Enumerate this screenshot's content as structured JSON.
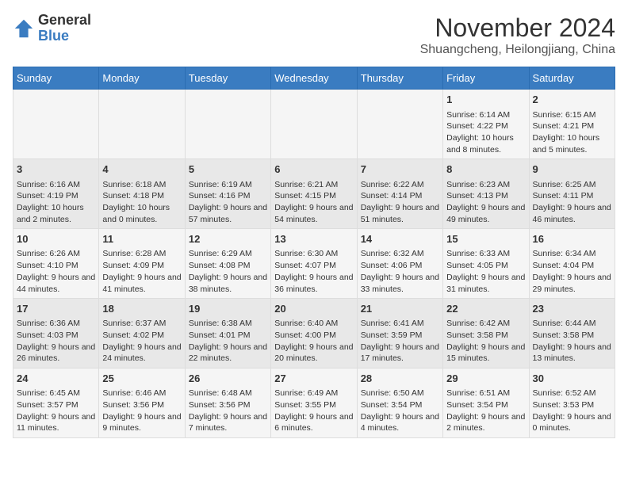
{
  "header": {
    "logo_general": "General",
    "logo_blue": "Blue",
    "month_title": "November 2024",
    "location": "Shuangcheng, Heilongjiang, China"
  },
  "days_of_week": [
    "Sunday",
    "Monday",
    "Tuesday",
    "Wednesday",
    "Thursday",
    "Friday",
    "Saturday"
  ],
  "weeks": [
    [
      {
        "day": "",
        "content": ""
      },
      {
        "day": "",
        "content": ""
      },
      {
        "day": "",
        "content": ""
      },
      {
        "day": "",
        "content": ""
      },
      {
        "day": "",
        "content": ""
      },
      {
        "day": "1",
        "content": "Sunrise: 6:14 AM\nSunset: 4:22 PM\nDaylight: 10 hours and 8 minutes."
      },
      {
        "day": "2",
        "content": "Sunrise: 6:15 AM\nSunset: 4:21 PM\nDaylight: 10 hours and 5 minutes."
      }
    ],
    [
      {
        "day": "3",
        "content": "Sunrise: 6:16 AM\nSunset: 4:19 PM\nDaylight: 10 hours and 2 minutes."
      },
      {
        "day": "4",
        "content": "Sunrise: 6:18 AM\nSunset: 4:18 PM\nDaylight: 10 hours and 0 minutes."
      },
      {
        "day": "5",
        "content": "Sunrise: 6:19 AM\nSunset: 4:16 PM\nDaylight: 9 hours and 57 minutes."
      },
      {
        "day": "6",
        "content": "Sunrise: 6:21 AM\nSunset: 4:15 PM\nDaylight: 9 hours and 54 minutes."
      },
      {
        "day": "7",
        "content": "Sunrise: 6:22 AM\nSunset: 4:14 PM\nDaylight: 9 hours and 51 minutes."
      },
      {
        "day": "8",
        "content": "Sunrise: 6:23 AM\nSunset: 4:13 PM\nDaylight: 9 hours and 49 minutes."
      },
      {
        "day": "9",
        "content": "Sunrise: 6:25 AM\nSunset: 4:11 PM\nDaylight: 9 hours and 46 minutes."
      }
    ],
    [
      {
        "day": "10",
        "content": "Sunrise: 6:26 AM\nSunset: 4:10 PM\nDaylight: 9 hours and 44 minutes."
      },
      {
        "day": "11",
        "content": "Sunrise: 6:28 AM\nSunset: 4:09 PM\nDaylight: 9 hours and 41 minutes."
      },
      {
        "day": "12",
        "content": "Sunrise: 6:29 AM\nSunset: 4:08 PM\nDaylight: 9 hours and 38 minutes."
      },
      {
        "day": "13",
        "content": "Sunrise: 6:30 AM\nSunset: 4:07 PM\nDaylight: 9 hours and 36 minutes."
      },
      {
        "day": "14",
        "content": "Sunrise: 6:32 AM\nSunset: 4:06 PM\nDaylight: 9 hours and 33 minutes."
      },
      {
        "day": "15",
        "content": "Sunrise: 6:33 AM\nSunset: 4:05 PM\nDaylight: 9 hours and 31 minutes."
      },
      {
        "day": "16",
        "content": "Sunrise: 6:34 AM\nSunset: 4:04 PM\nDaylight: 9 hours and 29 minutes."
      }
    ],
    [
      {
        "day": "17",
        "content": "Sunrise: 6:36 AM\nSunset: 4:03 PM\nDaylight: 9 hours and 26 minutes."
      },
      {
        "day": "18",
        "content": "Sunrise: 6:37 AM\nSunset: 4:02 PM\nDaylight: 9 hours and 24 minutes."
      },
      {
        "day": "19",
        "content": "Sunrise: 6:38 AM\nSunset: 4:01 PM\nDaylight: 9 hours and 22 minutes."
      },
      {
        "day": "20",
        "content": "Sunrise: 6:40 AM\nSunset: 4:00 PM\nDaylight: 9 hours and 20 minutes."
      },
      {
        "day": "21",
        "content": "Sunrise: 6:41 AM\nSunset: 3:59 PM\nDaylight: 9 hours and 17 minutes."
      },
      {
        "day": "22",
        "content": "Sunrise: 6:42 AM\nSunset: 3:58 PM\nDaylight: 9 hours and 15 minutes."
      },
      {
        "day": "23",
        "content": "Sunrise: 6:44 AM\nSunset: 3:58 PM\nDaylight: 9 hours and 13 minutes."
      }
    ],
    [
      {
        "day": "24",
        "content": "Sunrise: 6:45 AM\nSunset: 3:57 PM\nDaylight: 9 hours and 11 minutes."
      },
      {
        "day": "25",
        "content": "Sunrise: 6:46 AM\nSunset: 3:56 PM\nDaylight: 9 hours and 9 minutes."
      },
      {
        "day": "26",
        "content": "Sunrise: 6:48 AM\nSunset: 3:56 PM\nDaylight: 9 hours and 7 minutes."
      },
      {
        "day": "27",
        "content": "Sunrise: 6:49 AM\nSunset: 3:55 PM\nDaylight: 9 hours and 6 minutes."
      },
      {
        "day": "28",
        "content": "Sunrise: 6:50 AM\nSunset: 3:54 PM\nDaylight: 9 hours and 4 minutes."
      },
      {
        "day": "29",
        "content": "Sunrise: 6:51 AM\nSunset: 3:54 PM\nDaylight: 9 hours and 2 minutes."
      },
      {
        "day": "30",
        "content": "Sunrise: 6:52 AM\nSunset: 3:53 PM\nDaylight: 9 hours and 0 minutes."
      }
    ]
  ]
}
